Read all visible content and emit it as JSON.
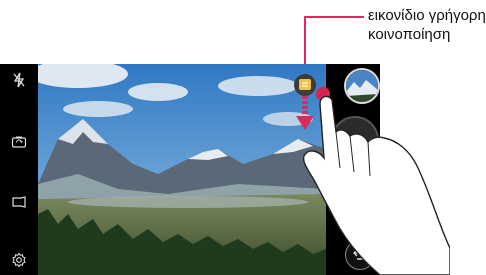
{
  "callout": {
    "line1": "εικονίδιο γρήγορη",
    "line2": "κοινοποίηση",
    "color": "#e0285a"
  },
  "left_bar": {
    "items": [
      {
        "name": "flash-off-icon"
      },
      {
        "name": "switch-camera-icon"
      },
      {
        "name": "camera-mode-icon"
      },
      {
        "name": "settings-icon"
      }
    ]
  },
  "right_bar": {
    "gallery_thumbnail": "gallery-thumbnail",
    "shutter": "shutter-button",
    "back": "back-icon"
  },
  "quick_share": {
    "icon": "quick-share-icon",
    "accent": "#f2c14e",
    "indicator_color": "#d8224f"
  }
}
